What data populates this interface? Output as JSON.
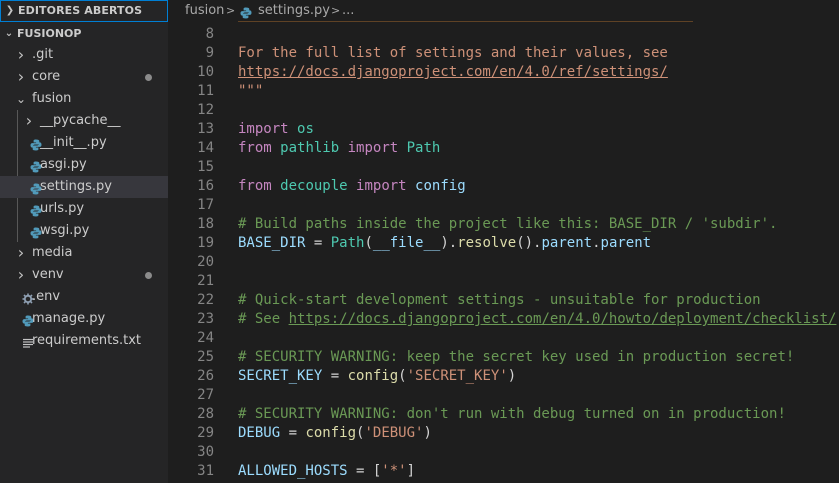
{
  "sidebar": {
    "open_editors_label": "EDITORES ABERTOS",
    "project_label": "FUSIONOP",
    "items": [
      {
        "label": ".git",
        "type": "folder",
        "indent": 0,
        "expanded": false,
        "modified": false
      },
      {
        "label": "core",
        "type": "folder",
        "indent": 0,
        "expanded": false,
        "modified": true
      },
      {
        "label": "fusion",
        "type": "folder",
        "indent": 0,
        "expanded": true,
        "modified": false
      },
      {
        "label": "__pycache__",
        "type": "folder",
        "indent": 1,
        "expanded": false,
        "modified": false
      },
      {
        "label": "__init__.py",
        "type": "python",
        "indent": 1,
        "modified": false
      },
      {
        "label": "asgi.py",
        "type": "python",
        "indent": 1,
        "modified": false
      },
      {
        "label": "settings.py",
        "type": "python",
        "indent": 1,
        "modified": false,
        "selected": true
      },
      {
        "label": "urls.py",
        "type": "python",
        "indent": 1,
        "modified": false
      },
      {
        "label": "wsgi.py",
        "type": "python",
        "indent": 1,
        "modified": false
      },
      {
        "label": "media",
        "type": "folder",
        "indent": 0,
        "expanded": false,
        "modified": false
      },
      {
        "label": "venv",
        "type": "folder",
        "indent": 0,
        "expanded": false,
        "modified": true
      },
      {
        "label": ".env",
        "type": "gear",
        "indent": 0,
        "modified": false
      },
      {
        "label": "manage.py",
        "type": "python",
        "indent": 0,
        "modified": false
      },
      {
        "label": "requirements.txt",
        "type": "text",
        "indent": 0,
        "modified": false
      }
    ]
  },
  "breadcrumb": {
    "folder": "fusion",
    "separator": ">",
    "file": "settings.py",
    "ellipsis": "..."
  },
  "editor": {
    "lines": [
      {
        "n": "8",
        "tokens": []
      },
      {
        "n": "9",
        "tokens": [
          {
            "t": "For the full list of settings and their values, see",
            "c": "s-str"
          }
        ]
      },
      {
        "n": "10",
        "tokens": [
          {
            "t": "https://docs.djangoproject.com/en/4.0/ref/settings/",
            "c": "s-url"
          }
        ]
      },
      {
        "n": "11",
        "tokens": [
          {
            "t": "\"\"\"",
            "c": "s-str"
          }
        ]
      },
      {
        "n": "12",
        "tokens": []
      },
      {
        "n": "13",
        "tokens": [
          {
            "t": "import",
            "c": "s-kw"
          },
          {
            "t": " ",
            "c": "s-op"
          },
          {
            "t": "os",
            "c": "s-mod"
          }
        ]
      },
      {
        "n": "14",
        "tokens": [
          {
            "t": "from",
            "c": "s-kw"
          },
          {
            "t": " ",
            "c": "s-op"
          },
          {
            "t": "pathlib",
            "c": "s-mod"
          },
          {
            "t": " ",
            "c": "s-op"
          },
          {
            "t": "import",
            "c": "s-kw"
          },
          {
            "t": " ",
            "c": "s-op"
          },
          {
            "t": "Path",
            "c": "s-mod"
          }
        ]
      },
      {
        "n": "15",
        "tokens": []
      },
      {
        "n": "16",
        "tokens": [
          {
            "t": "from",
            "c": "s-kw"
          },
          {
            "t": " ",
            "c": "s-op"
          },
          {
            "t": "decouple",
            "c": "s-mod"
          },
          {
            "t": " ",
            "c": "s-op"
          },
          {
            "t": "import",
            "c": "s-kw"
          },
          {
            "t": " ",
            "c": "s-op"
          },
          {
            "t": "config",
            "c": "s-var"
          }
        ]
      },
      {
        "n": "17",
        "tokens": []
      },
      {
        "n": "18",
        "tokens": [
          {
            "t": "# Build paths inside the project like this: BASE_DIR / 'subdir'.",
            "c": "s-com"
          }
        ]
      },
      {
        "n": "19",
        "tokens": [
          {
            "t": "BASE_DIR",
            "c": "s-var"
          },
          {
            "t": " = ",
            "c": "s-op"
          },
          {
            "t": "Path",
            "c": "s-bi"
          },
          {
            "t": "(",
            "c": "s-op"
          },
          {
            "t": "__file__",
            "c": "s-var"
          },
          {
            "t": ").",
            "c": "s-op"
          },
          {
            "t": "resolve",
            "c": "s-fn"
          },
          {
            "t": "().",
            "c": "s-op"
          },
          {
            "t": "parent",
            "c": "s-var"
          },
          {
            "t": ".",
            "c": "s-op"
          },
          {
            "t": "parent",
            "c": "s-var"
          }
        ]
      },
      {
        "n": "20",
        "tokens": []
      },
      {
        "n": "21",
        "tokens": []
      },
      {
        "n": "22",
        "tokens": [
          {
            "t": "# Quick-start development settings - unsuitable for production",
            "c": "s-com"
          }
        ]
      },
      {
        "n": "23",
        "tokens": [
          {
            "t": "# See ",
            "c": "s-com"
          },
          {
            "t": "https://docs.djangoproject.com/en/4.0/howto/deployment/checklist/",
            "c": "s-com-url"
          }
        ]
      },
      {
        "n": "24",
        "tokens": []
      },
      {
        "n": "25",
        "tokens": [
          {
            "t": "# SECURITY WARNING: keep the secret key used in production secret!",
            "c": "s-com"
          }
        ]
      },
      {
        "n": "26",
        "tokens": [
          {
            "t": "SECRET_KEY",
            "c": "s-var"
          },
          {
            "t": " = ",
            "c": "s-op"
          },
          {
            "t": "config",
            "c": "s-fn"
          },
          {
            "t": "(",
            "c": "s-op"
          },
          {
            "t": "'SECRET_KEY'",
            "c": "s-str"
          },
          {
            "t": ")",
            "c": "s-op"
          }
        ]
      },
      {
        "n": "27",
        "tokens": []
      },
      {
        "n": "28",
        "tokens": [
          {
            "t": "# SECURITY WARNING: don't run with debug turned on in production!",
            "c": "s-com"
          }
        ]
      },
      {
        "n": "29",
        "tokens": [
          {
            "t": "DEBUG",
            "c": "s-var"
          },
          {
            "t": " = ",
            "c": "s-op"
          },
          {
            "t": "config",
            "c": "s-fn"
          },
          {
            "t": "(",
            "c": "s-op"
          },
          {
            "t": "'DEBUG'",
            "c": "s-str"
          },
          {
            "t": ")",
            "c": "s-op"
          }
        ]
      },
      {
        "n": "30",
        "tokens": []
      },
      {
        "n": "31",
        "tokens": [
          {
            "t": "ALLOWED_HOSTS",
            "c": "s-var"
          },
          {
            "t": " = [",
            "c": "s-op"
          },
          {
            "t": "'*'",
            "c": "s-str"
          },
          {
            "t": "]",
            "c": "s-op"
          }
        ]
      }
    ]
  },
  "colors": {
    "background": "#1e1e1e",
    "sidebar": "#252526",
    "selection": "#37373d",
    "focus_border": "#007fd4",
    "python_icon": "#519aba",
    "modified_dot": "#8b8b8b"
  },
  "icons": {
    "python": "python-file-icon",
    "gear": "gear-icon",
    "text": "text-lines-icon",
    "folder_closed": "chevron-right-icon",
    "folder_open": "chevron-down-icon"
  }
}
